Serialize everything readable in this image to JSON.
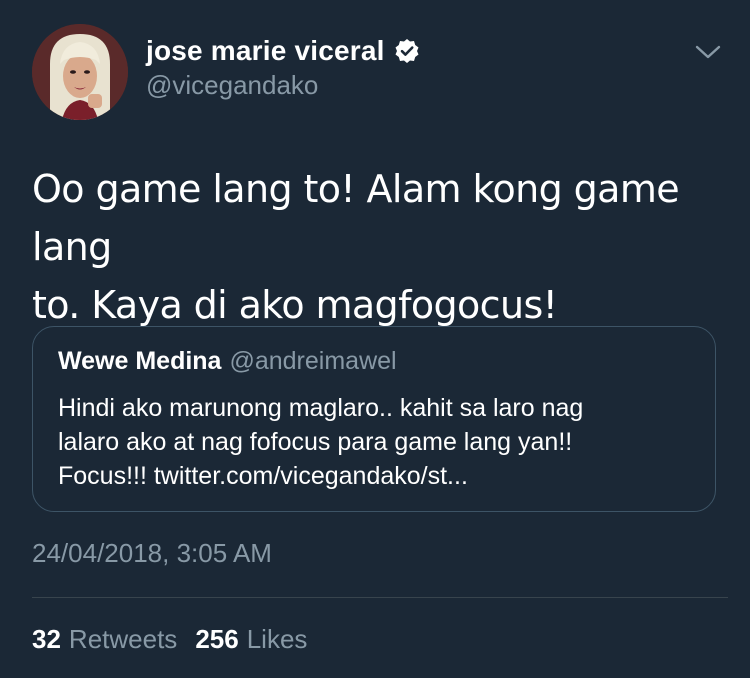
{
  "author": {
    "name": "jose marie viceral",
    "handle": "@vicegandako",
    "verified": true
  },
  "tweet": {
    "text_lines": [
      "Oo game lang to! Alam kong game lang",
      "to. Kaya di ako magfogocus!"
    ],
    "timestamp": "24/04/2018, 3:05 AM"
  },
  "quoted_tweet": {
    "name": "Wewe Medina",
    "handle": "@andreimawel",
    "text_lines": [
      "Hindi ako marunong maglaro.. kahit sa laro nag",
      "lalaro ako at nag fofocus para game lang yan!!",
      "Focus!!! twitter.com/vicegandako/st..."
    ]
  },
  "stats": {
    "retweets_count": "32",
    "retweets_label": "Retweets",
    "likes_count": "256",
    "likes_label": "Likes"
  },
  "colors": {
    "background": "#1b2836",
    "text_primary": "#ffffff",
    "text_secondary": "#8899a6",
    "border": "#3d5466"
  },
  "icons": {
    "verified": "verified-badge-icon",
    "menu": "chevron-down-icon"
  }
}
